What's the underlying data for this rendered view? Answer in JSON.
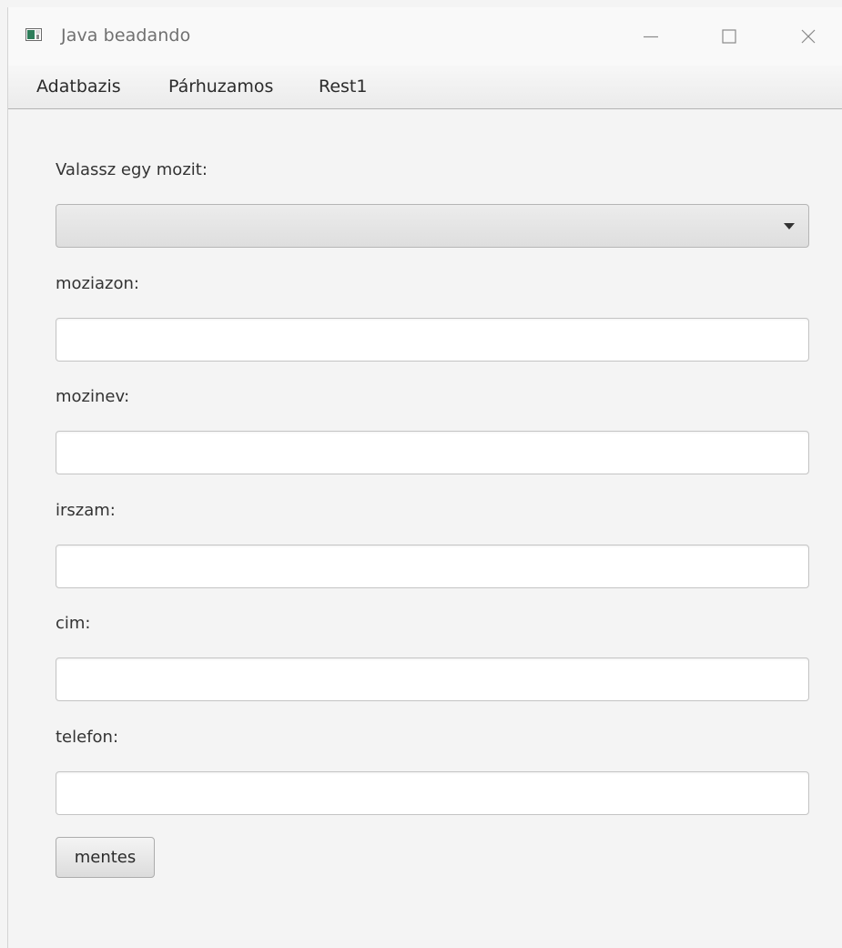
{
  "window": {
    "title": "Java beadando"
  },
  "menubar": {
    "items": [
      {
        "label": "Adatbazis"
      },
      {
        "label": "Párhuzamos"
      },
      {
        "label": "Rest1"
      }
    ]
  },
  "form": {
    "select_label": "Valassz egy mozit:",
    "select_value": "",
    "fields": [
      {
        "label": "moziazon:",
        "value": ""
      },
      {
        "label": "mozinev:",
        "value": ""
      },
      {
        "label": "irszam:",
        "value": ""
      },
      {
        "label": "cim:",
        "value": ""
      },
      {
        "label": "telefon:",
        "value": ""
      }
    ],
    "save_label": "mentes"
  },
  "icons": {
    "app": "java-app-icon",
    "minimize": "minimize-icon",
    "maximize": "maximize-icon",
    "close": "close-icon",
    "dropdown": "chevron-down-icon"
  }
}
